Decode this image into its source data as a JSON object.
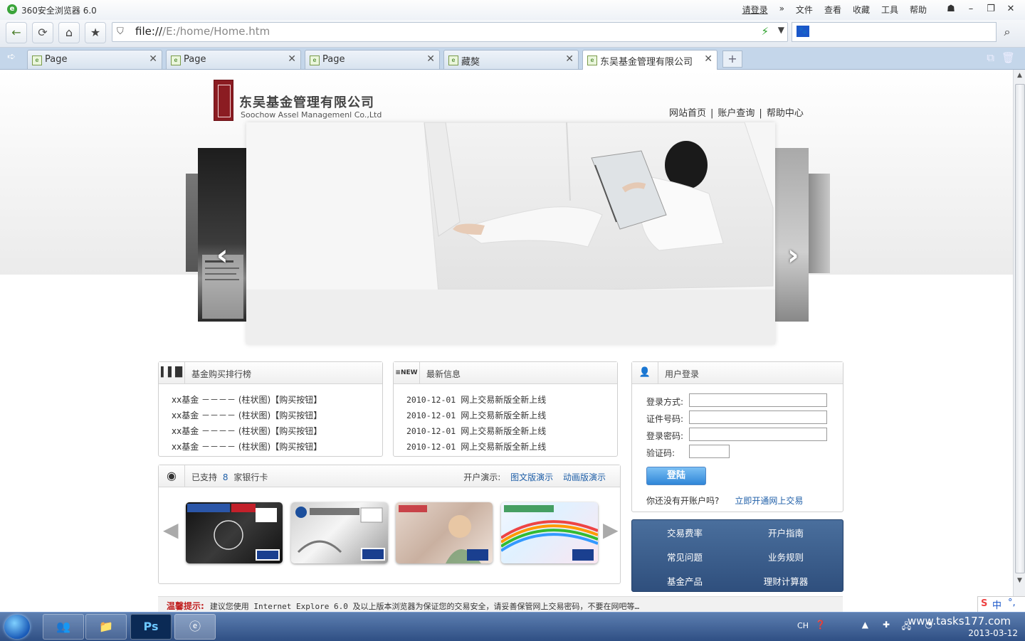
{
  "browser": {
    "title": "360安全浏览器 6.0",
    "menu": [
      "请登录",
      "文件",
      "查看",
      "收藏",
      "工具",
      "帮助"
    ],
    "url": "file:///E:/home/Home.htm",
    "url_prefix": "file://",
    "url_path": "/E:/home/Home.htm",
    "tabs": [
      "Page",
      "Page",
      "Page",
      "藏獒",
      "东吴基金管理有限公司"
    ],
    "active_tab_index": 4
  },
  "site": {
    "brand_cn": "东吴基金管理有限公司",
    "brand_en": "Soochow Assel Managemenl Co.,Ltd",
    "nav": [
      "网站首页",
      "账户查询",
      "帮助中心"
    ]
  },
  "ranking": {
    "title": "基金购买排行榜",
    "rows": [
      "xx基金 －－－－ (柱状图)【购买按钮】",
      "xx基金 －－－－ (柱状图)【购买按钮】",
      "xx基金 －－－－ (柱状图)【购买按钮】",
      "xx基金 －－－－ (柱状图)【购买按钮】"
    ]
  },
  "news": {
    "title": "最新信息",
    "items": [
      {
        "date": "2010-12-01",
        "text": "网上交易新版全新上线"
      },
      {
        "date": "2010-12-01",
        "text": "网上交易新版全新上线"
      },
      {
        "date": "2010-12-01",
        "text": "网上交易新版全新上线"
      },
      {
        "date": "2010-12-01",
        "text": "网上交易新版全新上线"
      }
    ]
  },
  "login": {
    "title": "用户登录",
    "fields": [
      "登录方式:",
      "证件号码:",
      "登录密码:",
      "验证码:"
    ],
    "button": "登陆",
    "no_account": "你还没有开账户吗?",
    "open_link": "立即开通网上交易"
  },
  "quick_links": [
    "交易费率",
    "开户指南",
    "常见问题",
    "业务规则",
    "基金产品",
    "理财计算器"
  ],
  "banks": {
    "prefix": "已支持",
    "count": "8",
    "suffix": "家银行卡",
    "demo_label": "开户演示:",
    "demo_links": [
      "图文版演示",
      "动画版演示"
    ]
  },
  "tip": {
    "label": "温馨提示:",
    "text": "建议您使用 Internet Explore 6.0 及以上版本浏览器为保证您的交易安全，请妥善保管网上交易密码，不要在网吧等…"
  },
  "taskbar": {
    "lang": "CH",
    "date": "2013-03-12",
    "watermark": "www.tasks177.com",
    "ime": "中"
  },
  "colors": {
    "accent_blue": "#1f5fa8",
    "tip_red": "#c02020",
    "seal_red": "#8b1c22"
  }
}
